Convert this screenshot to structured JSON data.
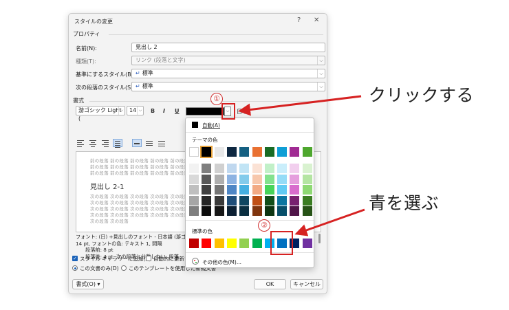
{
  "dialog": {
    "title": "スタイルの変更",
    "help_glyph": "?",
    "close_glyph": "✕",
    "properties_section": "プロパティ",
    "fields": [
      {
        "label": "名前(N):",
        "value": "見出し 2"
      },
      {
        "label": "種類(T):",
        "value": "リンク (段落と文字)"
      },
      {
        "label": "基準にするスタイル(B):",
        "value": "標準"
      },
      {
        "label": "次の段落のスタイル(S):",
        "value": "標準"
      }
    ],
    "format_section": "書式",
    "font_name": "游ゴシック Light (",
    "font_size": "14",
    "bold": "B",
    "italic": "I",
    "underline": "U",
    "language": "日本",
    "preview": {
      "prev_para": "前の段落 前の段落 前の段落 前の段落 前の段落 前の段落",
      "heading": "見出し 2-1",
      "next_para": "次の段落 次の段落 次の段落 次の段落 次の段落 次の段落",
      "next_para_last": "次の段落 次の段落"
    },
    "description": [
      "フォント: (日) +見出しのフォント - 日本語 (游ゴシ",
      "14 pt, フォントの色: テキスト 1, 間隔",
      "段落前:  8 pt",
      "段落後:  4 pt, 次の段落と分離しない, 段落"
    ],
    "add_gallery": "スタイル ギャラリーに追加(S)",
    "auto_update": "自動的に更新す",
    "this_doc_only": "この文書のみ(D)",
    "new_docs": "このテンプレートを使用した新規文書",
    "format_button": "書式(O) ▾",
    "ok_button": "OK",
    "cancel_button": "キャンセル"
  },
  "color_popup": {
    "automatic": "自動(A)",
    "theme_title": "テーマの色",
    "standard_title": "標準の色",
    "more_colors": "その他の色(M)...",
    "theme_top": [
      "#000000",
      "#ffffff",
      "#e7e6e6",
      "#44546a",
      "#4472c4",
      "#ed7d31",
      "#a5a5a5",
      "#ffc000",
      "#5b9bd5",
      "#70ad47"
    ],
    "theme_top_shown": [
      "#ffffff",
      "#000000",
      "#e8e8e8",
      "#0e2841",
      "#156082",
      "#e97132",
      "#196b24",
      "#0f9ed5",
      "#a02b93",
      "#4ea72e"
    ],
    "theme_columns": [
      [
        "#f2f2f2",
        "#d9d9d9",
        "#bfbfbf",
        "#a6a6a6",
        "#7f7f7f"
      ],
      [
        "#7f7f7f",
        "#595959",
        "#404040",
        "#262626",
        "#0d0d0d"
      ],
      [
        "#d0d0d0",
        "#aeaeae",
        "#757575",
        "#3a3a3a",
        "#171717"
      ],
      [
        "#c0d8ef",
        "#8db3e2",
        "#4e86c5",
        "#1f4e79",
        "#0c2033"
      ],
      [
        "#c1e4f5",
        "#83cbeb",
        "#45b0e1",
        "#0f4761",
        "#0a2f41"
      ],
      [
        "#fbe2d5",
        "#f7c7ac",
        "#f2aa84",
        "#c04f15",
        "#80350e"
      ],
      [
        "#c1f0c8",
        "#83e28e",
        "#47d459",
        "#124f1a",
        "#0d3512"
      ],
      [
        "#caeefb",
        "#95dcf7",
        "#61cbf3",
        "#0b76a0",
        "#074f6a"
      ],
      [
        "#f2cfee",
        "#e59edd",
        "#d86dcd",
        "#782170",
        "#501549"
      ],
      [
        "#d9f2d0",
        "#b4e5a2",
        "#8ed973",
        "#3b7d23",
        "#275317"
      ]
    ],
    "standard": [
      "#c00000",
      "#ff0000",
      "#ffc000",
      "#ffff00",
      "#92d050",
      "#00b050",
      "#00b0f0",
      "#0070c0",
      "#002060",
      "#7030a0"
    ]
  },
  "annotations": {
    "step1_num": "①",
    "step1_text": "クリックする",
    "step2_num": "②",
    "step2_text": "青を選ぶ",
    "accent": "#d62222"
  }
}
